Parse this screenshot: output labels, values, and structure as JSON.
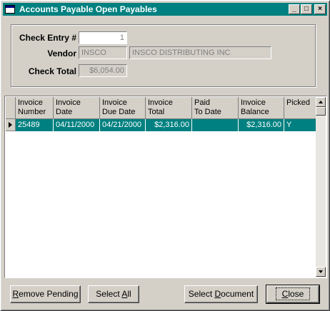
{
  "window": {
    "title": "Accounts Payable Open Payables",
    "controls": [
      "minimize-icon",
      "maximize-icon",
      "close-icon"
    ]
  },
  "form": {
    "check_entry_label": "Check Entry #",
    "check_entry_value": "1",
    "vendor_label": "Vendor",
    "vendor_code": "INSCO",
    "vendor_name": "INSCO DISTRIBUTING INC",
    "check_total_label": "Check Total",
    "check_total_value": "$6,054.00"
  },
  "grid": {
    "columns": [
      "Invoice\nNumber",
      "Invoice\nDate",
      "Invoice\nDue Date",
      "Invoice\nTotal",
      "Paid\nTo Date",
      "Invoice\nBalance",
      "Picked"
    ],
    "rows": [
      [
        "25489",
        "04/11/2000",
        "04/21/2000",
        "$2,316.00",
        "",
        "$2,316.00",
        "Y"
      ]
    ]
  },
  "buttons": {
    "remove_pending_u": "R",
    "remove_pending_rest": "emove Pending",
    "select_all_pre": "Select ",
    "select_all_u": "A",
    "select_all_post": "ll",
    "select_document_pre": "Select ",
    "select_document_u": "D",
    "select_document_post": "ocument",
    "close_u": "C",
    "close_rest": "lose"
  },
  "colors": {
    "titlebar": "#008080",
    "selection": "#008080",
    "face": "#d4d0c8"
  }
}
